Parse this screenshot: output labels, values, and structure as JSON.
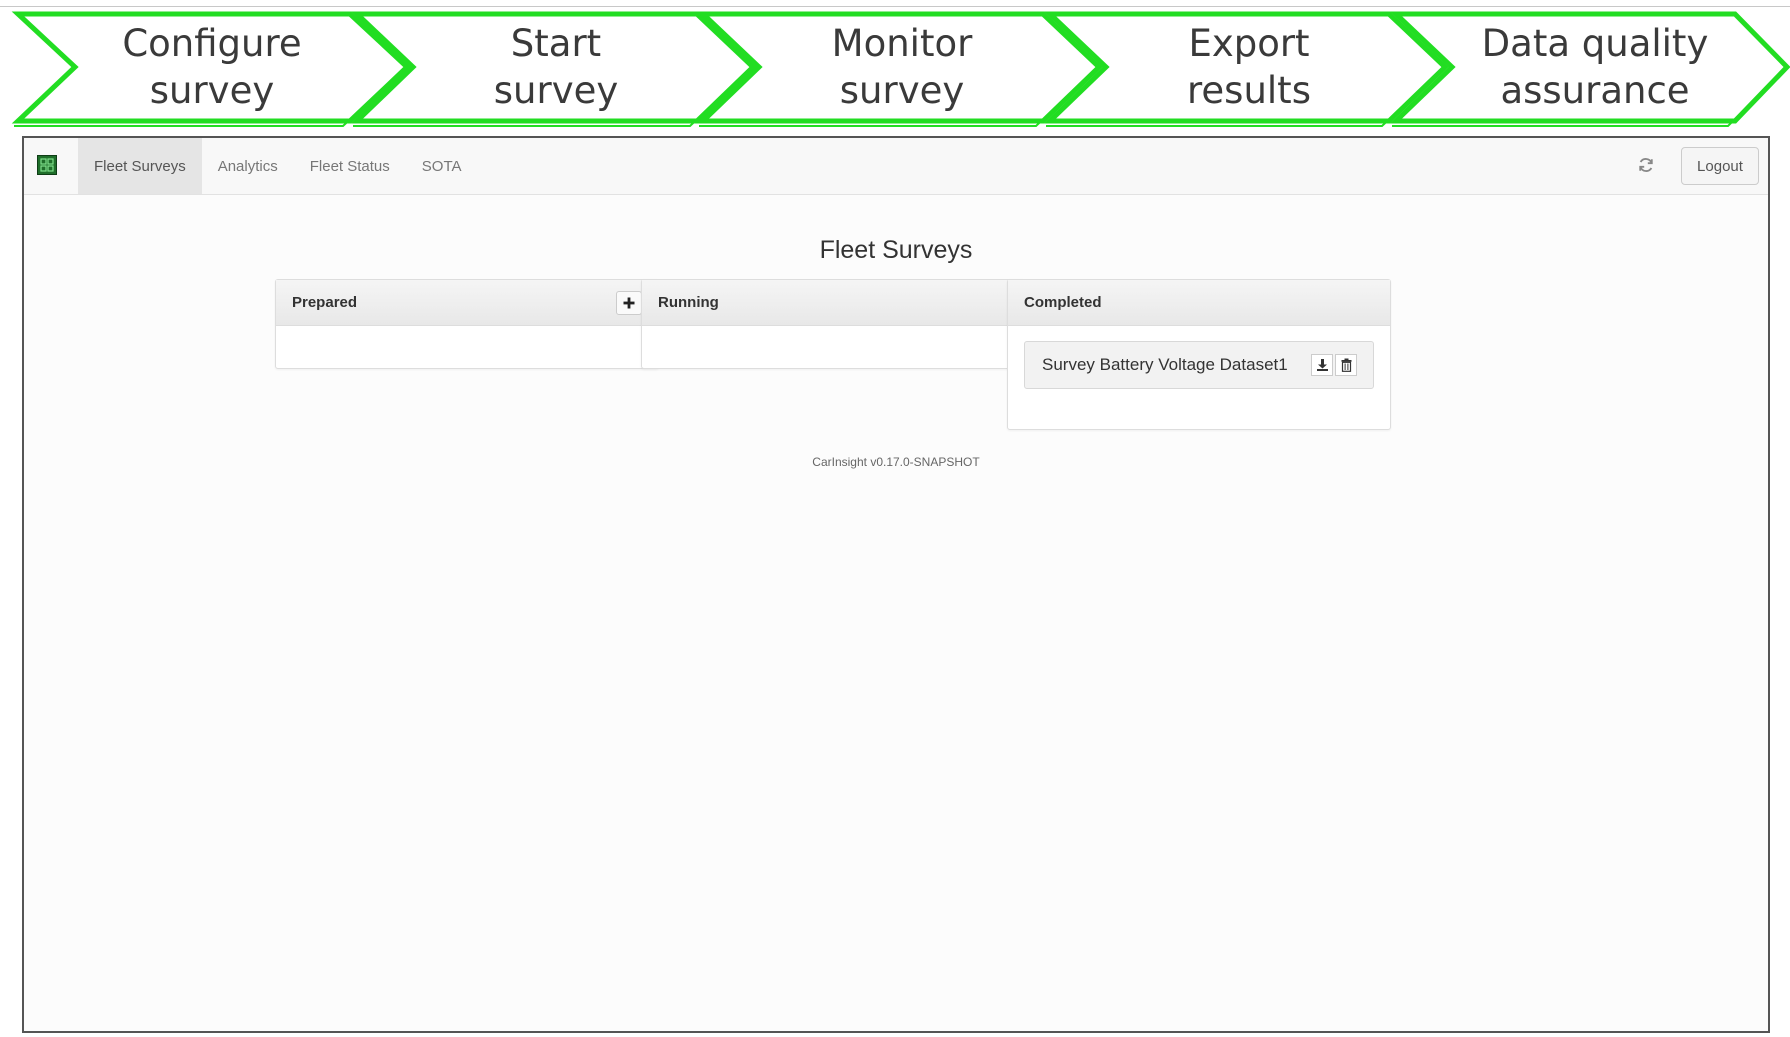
{
  "workflow": {
    "accent_color": "#22dd22",
    "steps": [
      {
        "label": "Configure\nsurvey"
      },
      {
        "label": "Start\nsurvey"
      },
      {
        "label": "Monitor\nsurvey"
      },
      {
        "label": "Export\nresults"
      },
      {
        "label": "Data quality\nassurance"
      }
    ]
  },
  "app": {
    "brand_icon": "grid-logo-icon",
    "nav": {
      "tabs": [
        {
          "label": "Fleet Surveys",
          "active": true
        },
        {
          "label": "Analytics",
          "active": false
        },
        {
          "label": "Fleet Status",
          "active": false
        },
        {
          "label": "SOTA",
          "active": false
        }
      ],
      "refresh_icon": "refresh-icon",
      "logout_label": "Logout"
    },
    "page_title": "Fleet Surveys",
    "panels": {
      "prepared": {
        "title": "Prepared",
        "add_icon": "plus-icon",
        "items": []
      },
      "running": {
        "title": "Running",
        "items": []
      },
      "completed": {
        "title": "Completed",
        "items": [
          {
            "name": "Survey Battery Voltage Dataset1",
            "download_icon": "download-icon",
            "delete_icon": "trash-icon"
          }
        ]
      }
    },
    "footer_version": "CarInsight v0.17.0-SNAPSHOT"
  }
}
